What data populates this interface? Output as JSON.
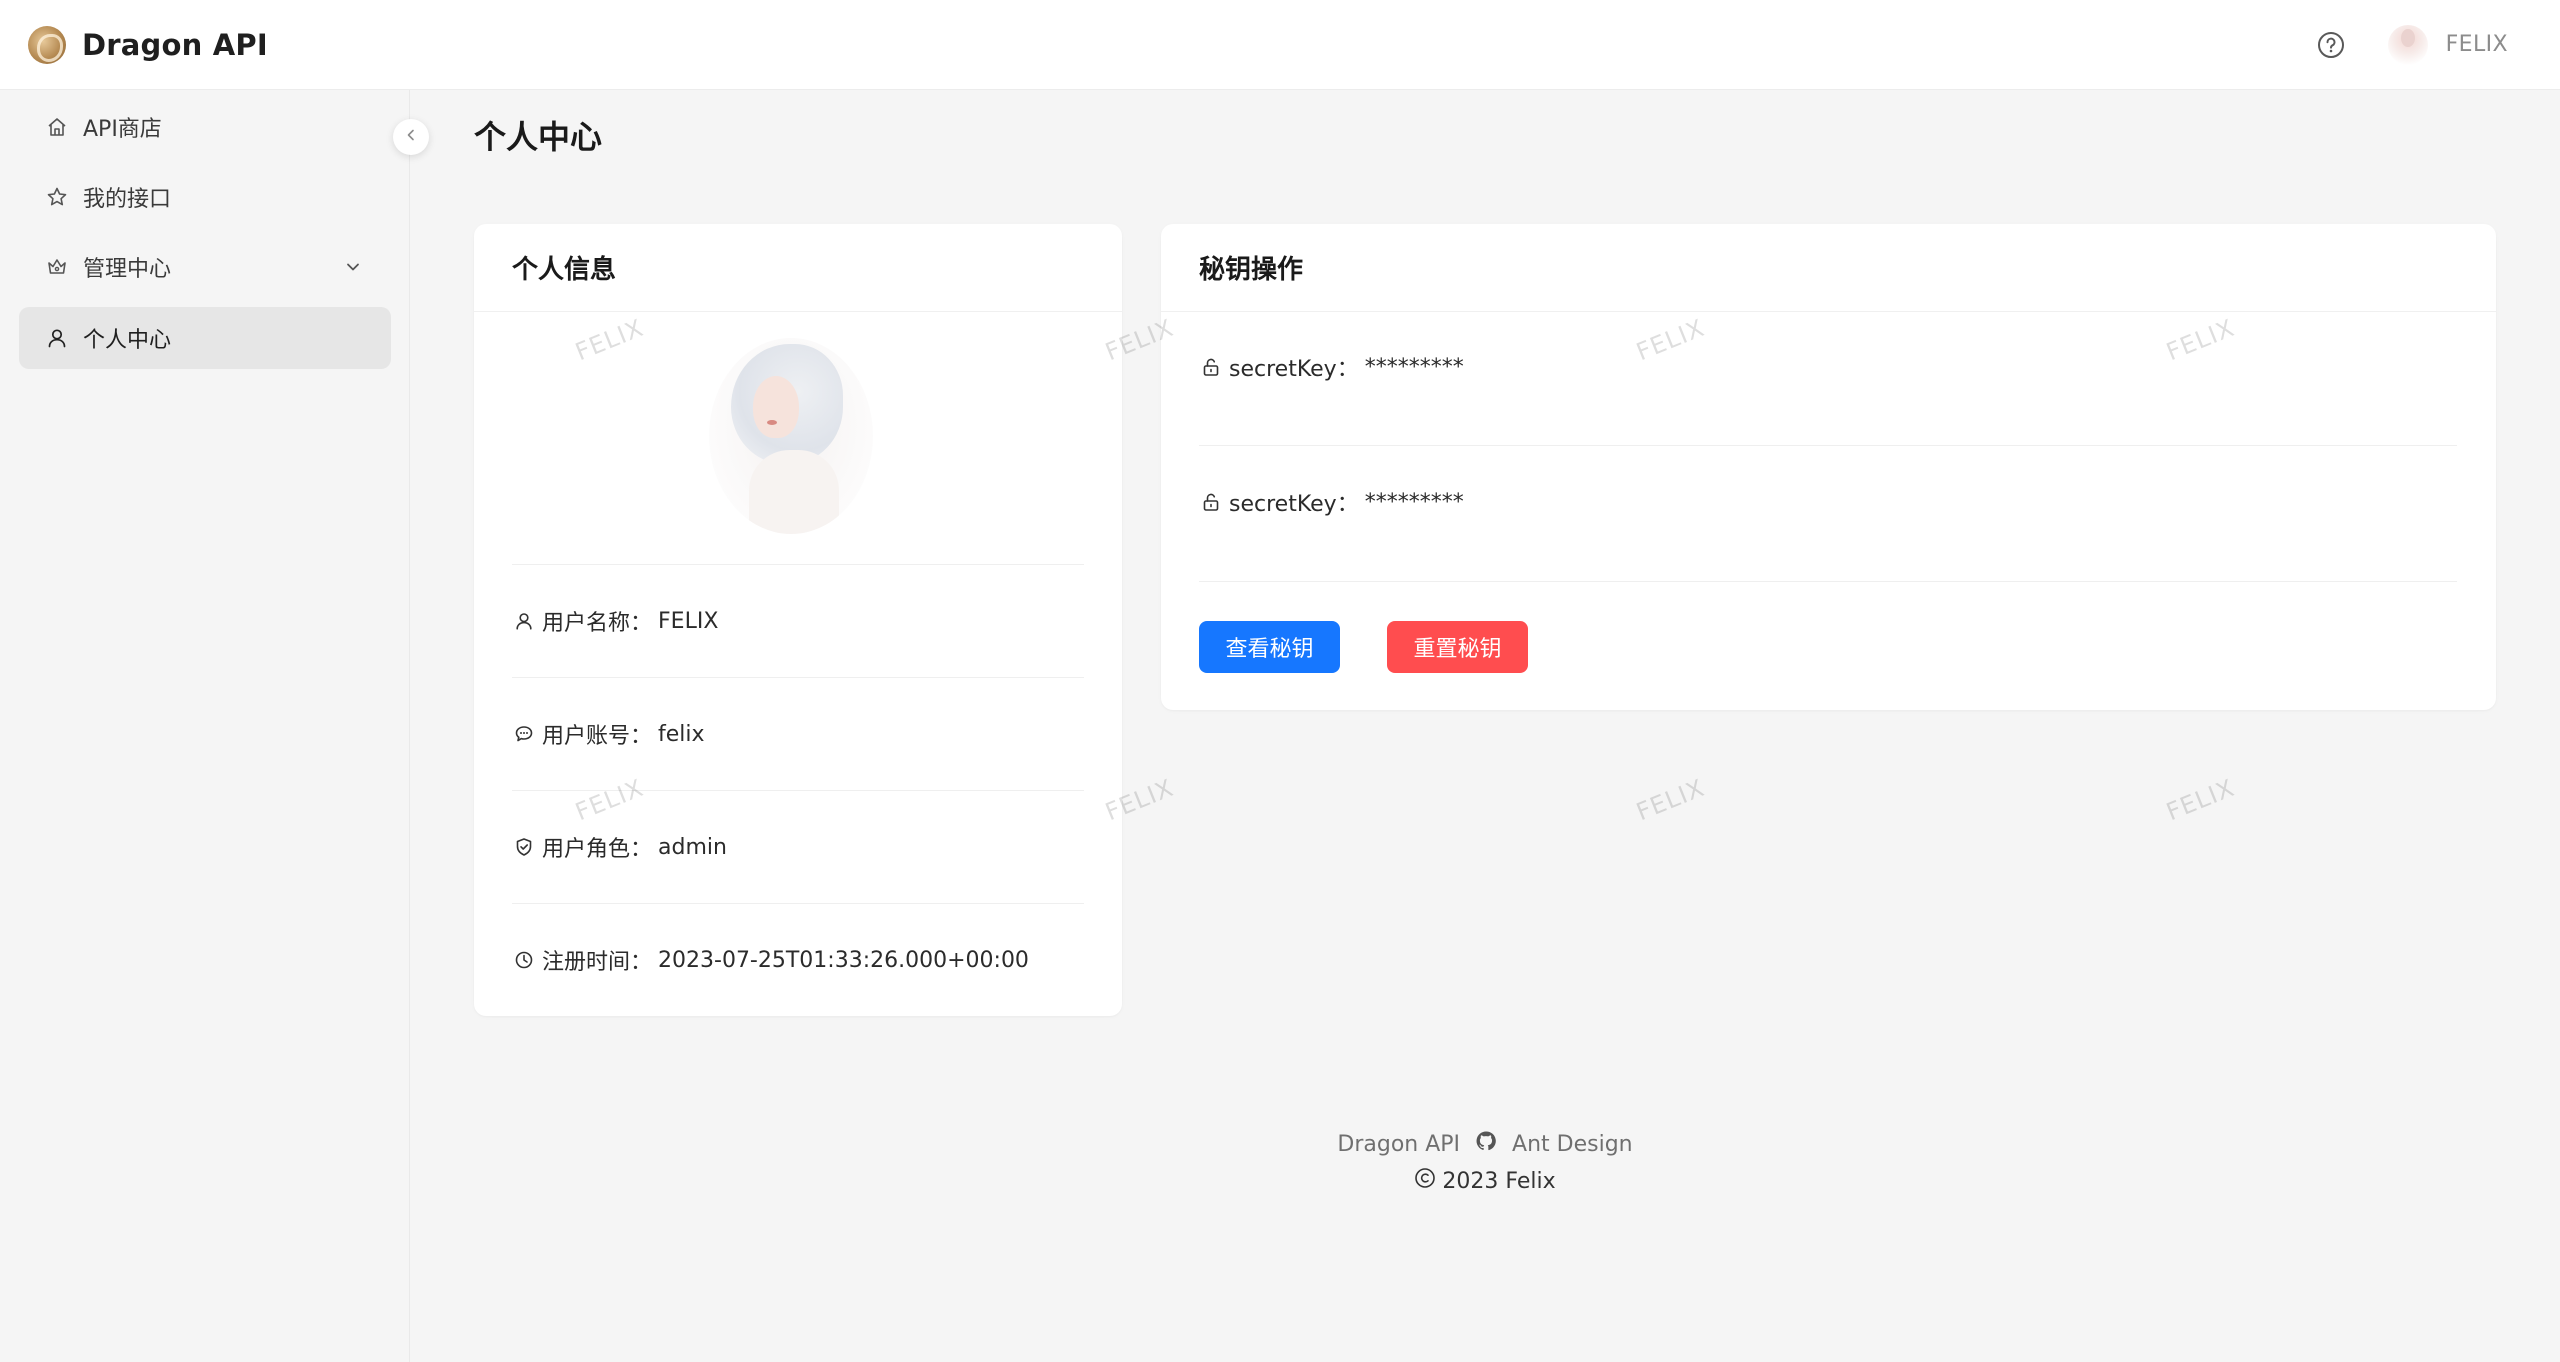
{
  "header": {
    "brand": "Dragon API",
    "user_name": "FELIX"
  },
  "sidebar": {
    "items": [
      {
        "label": "API商店",
        "icon": "home-icon"
      },
      {
        "label": "我的接口",
        "icon": "star-icon"
      },
      {
        "label": "管理中心",
        "icon": "crown-icon"
      },
      {
        "label": "个人中心",
        "icon": "user-icon"
      }
    ],
    "active_index": 3
  },
  "page": {
    "title": "个人中心"
  },
  "profile": {
    "title": "个人信息",
    "rows": [
      {
        "label": "用户名称：",
        "value": "FELIX",
        "icon": "user-icon"
      },
      {
        "label": "用户账号：",
        "value": "felix",
        "icon": "comment-icon"
      },
      {
        "label": "用户角色：",
        "value": "admin",
        "icon": "verified-shield-icon"
      },
      {
        "label": "注册时间：",
        "value": "2023-07-25T01:33:26.000+00:00",
        "icon": "clock-icon"
      }
    ]
  },
  "secret": {
    "title": "秘钥操作",
    "rows": [
      {
        "label": "secretKey：",
        "value": "*********",
        "icon": "unlock-icon"
      },
      {
        "label": "secretKey：",
        "value": "*********",
        "icon": "unlock-icon"
      }
    ],
    "view_button": "查看秘钥",
    "reset_button": "重置秘钥"
  },
  "watermark": "FELIX",
  "footer": {
    "link1": "Dragon API",
    "link2": "Ant Design",
    "copyright": "2023 Felix"
  },
  "colors": {
    "primary": "#1677ff",
    "danger": "#ff4d4f"
  }
}
